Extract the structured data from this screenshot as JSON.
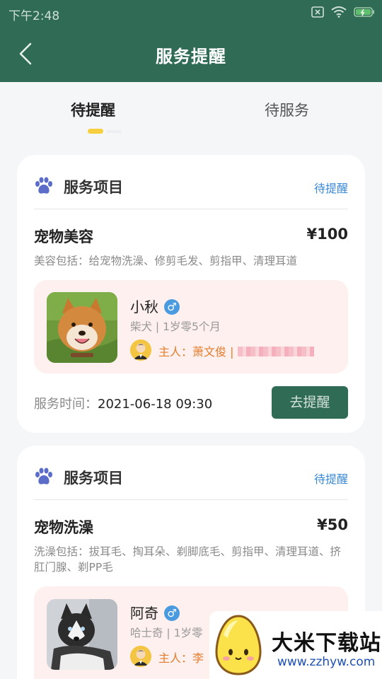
{
  "status_bar": {
    "time": "下午2:48"
  },
  "navbar": {
    "title": "服务提醒"
  },
  "tabs": [
    {
      "label": "待提醒",
      "active": true
    },
    {
      "label": "待服务",
      "active": false
    }
  ],
  "cards": [
    {
      "header_label": "服务项目",
      "status": "待提醒",
      "service_name": "宠物美容",
      "price": "¥100",
      "description": "美容包括：给宠物洗澡、修剪毛发、剪指甲、清理耳道",
      "pet": {
        "name": "小秋",
        "gender": "♂",
        "meta": "柴犬 | 1岁零5个月"
      },
      "owner_text": "主人：萧文俊 |",
      "service_time_label": "服务时间：",
      "service_time": "2021-06-18 09:30",
      "action_label": "去提醒"
    },
    {
      "header_label": "服务项目",
      "status": "待提醒",
      "service_name": "宠物洗澡",
      "price": "¥50",
      "description": "洗澡包括：拔耳毛、掏耳朵、剃脚底毛、剪指甲、清理耳道、挤肛门腺、剃PP毛",
      "pet": {
        "name": "阿奇",
        "gender": "♂",
        "meta": "哈士奇 | 1岁零"
      },
      "owner_text": "主人：李"
    }
  ],
  "watermark": {
    "name": "大米下载站",
    "url": "www.zzhyw.com"
  },
  "colors": {
    "primary": "#2f6b55",
    "accent": "#3a89d6",
    "indicator": "#f7cf3e",
    "pet_box": "#fef0ef",
    "owner": "#e57c2a"
  }
}
